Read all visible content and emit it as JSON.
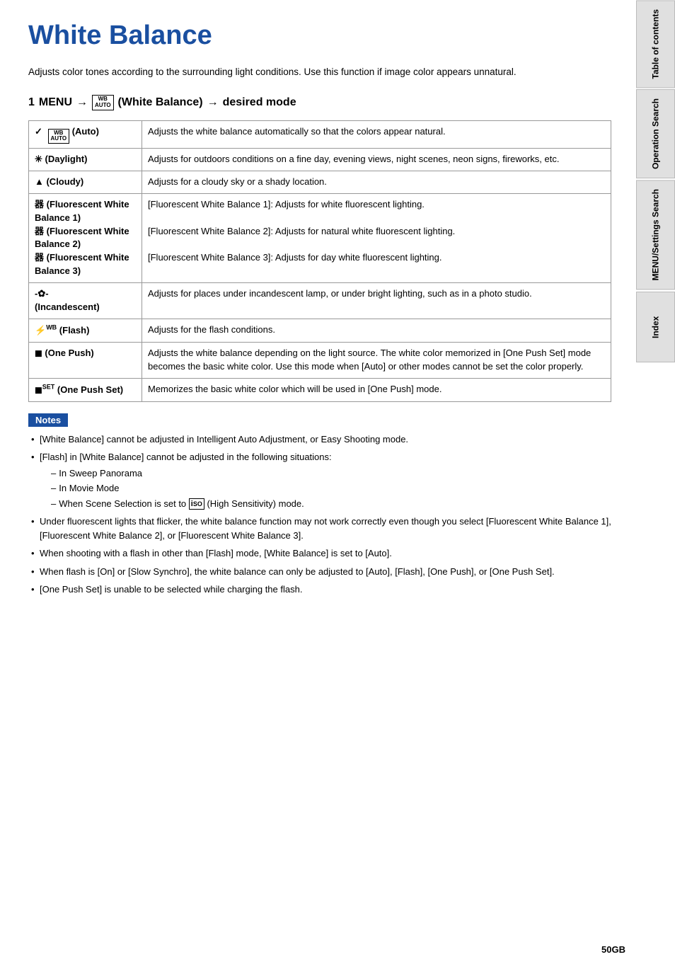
{
  "page": {
    "title": "White Balance",
    "intro": "Adjusts color tones according to the surrounding light conditions. Use this function if image color appears unnatural.",
    "menu_instruction": "1  MENU →  WB AUTO  (White Balance) → desired mode",
    "menu_step1": "1",
    "menu_label": "MENU",
    "menu_icon_top": "WB",
    "menu_icon_bottom": "AUTO",
    "menu_parens": "(White Balance)",
    "menu_end": "desired mode",
    "table": {
      "rows": [
        {
          "icon": "WB AUTO",
          "icon_type": "wb_auto",
          "label": "(Auto)",
          "has_check": true,
          "description": "Adjusts the white balance automatically so that the colors appear natural."
        },
        {
          "icon": "✳",
          "icon_type": "daylight",
          "label": "(Daylight)",
          "has_check": false,
          "description": "Adjusts for outdoors conditions on a fine day, evening views, night scenes, neon signs, fireworks, etc."
        },
        {
          "icon": "▲",
          "icon_type": "cloudy",
          "label": "(Cloudy)",
          "has_check": false,
          "description": "Adjusts for a cloudy sky or a shady location."
        },
        {
          "icon": "器",
          "icon_type": "fluorescent",
          "label_multi": [
            "器 (Fluorescent White Balance 1)",
            "器 (Fluorescent White Balance 2)",
            "器 (Fluorescent White Balance 3)"
          ],
          "has_check": false,
          "description_multi": [
            "[Fluorescent White Balance 1]: Adjusts for white fluorescent lighting.",
            "[Fluorescent White Balance 2]: Adjusts for natural white fluorescent lighting.",
            "[Fluorescent White Balance 3]: Adjusts for day white fluorescent lighting."
          ]
        },
        {
          "icon": "⊕",
          "icon_type": "incandescent",
          "label": "(Incandescent)",
          "has_check": false,
          "description": "Adjusts for places under incandescent lamp, or under bright lighting, such as in a photo studio."
        },
        {
          "icon": "⚡WB",
          "icon_type": "flash",
          "label": "(Flash)",
          "has_check": false,
          "description": "Adjusts for the flash conditions."
        },
        {
          "icon": "◼",
          "icon_type": "one_push",
          "label": "(One Push)",
          "has_check": false,
          "description": "Adjusts the white balance depending on the light source. The white color memorized in [One Push Set] mode becomes the basic white color. Use this mode when [Auto] or other modes cannot be set the color properly."
        },
        {
          "icon": "◼SET",
          "icon_type": "one_push_set",
          "label": "(One Push Set)",
          "has_check": false,
          "description": "Memorizes the basic white color which will be used in [One Push] mode."
        }
      ]
    },
    "notes": {
      "label": "Notes",
      "items": [
        "[White Balance] cannot be adjusted in Intelligent Auto Adjustment, or Easy Shooting mode.",
        "[Flash] in [White Balance] cannot be adjusted in the following situations:",
        "Under fluorescent lights that flicker, the white balance function may not work correctly even though you select [Fluorescent White Balance 1], [Fluorescent White Balance 2], or [Fluorescent White Balance 3].",
        "When shooting with a flash in other than [Flash] mode, [White Balance] is set to [Auto].",
        "When flash is [On] or [Slow Synchro], the white balance can only be adjusted to [Auto], [Flash], [One Push], or [One Push Set].",
        "[One Push Set] is unable to be selected while charging the flash."
      ],
      "sub_items": [
        "In Sweep Panorama",
        "In Movie Mode",
        "When Scene Selection is set to  ISO  (High Sensitivity) mode."
      ]
    },
    "page_number": "50GB"
  },
  "sidebar": {
    "tabs": [
      {
        "label": "Table of contents"
      },
      {
        "label": "Operation Search"
      },
      {
        "label": "MENU/Settings Search"
      },
      {
        "label": "Index"
      }
    ]
  }
}
